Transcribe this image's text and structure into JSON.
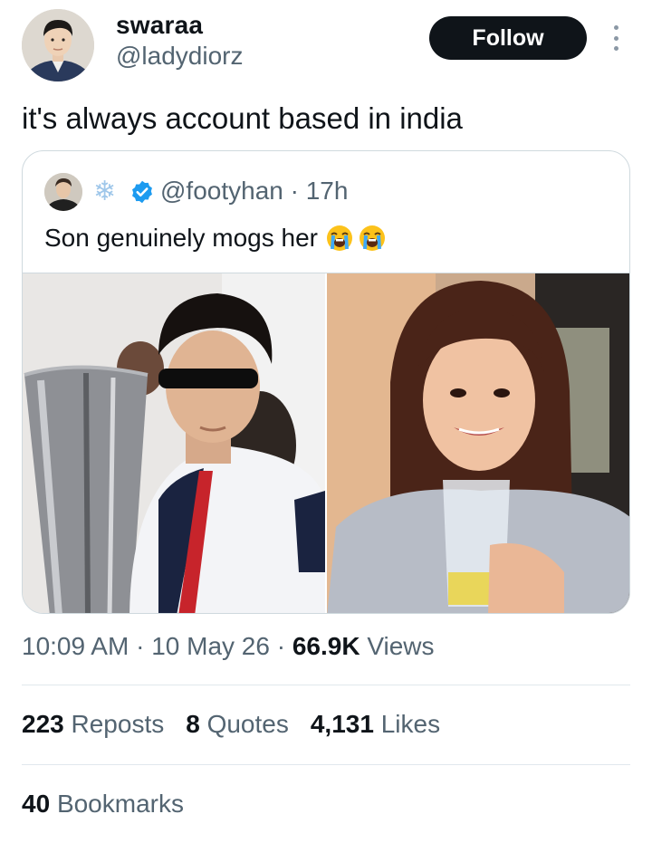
{
  "author": {
    "name": "swaraa",
    "handle": "@ladydiorz",
    "avatar_icon": "profile-photo"
  },
  "follow_label": "Follow",
  "tweet_text": "it's always account based in india",
  "quoted": {
    "handle": "@footyhan",
    "separator": " · ",
    "time": "17h",
    "text": "Son genuinely mogs her",
    "badge_icon": "snowflake-icon",
    "verified_icon": "verified-badge-icon",
    "emoji_icons": [
      "loudly-crying-face-emoji",
      "loudly-crying-face-emoji"
    ],
    "images": [
      "footballer-with-sunglasses-and-trophy-photo",
      "woman-smiling-holding-glass-photo"
    ]
  },
  "timestamp": {
    "time": "10:09 AM",
    "date": "10 May 26",
    "views_count": "66.9K",
    "views_label": "Views",
    "separator": " · "
  },
  "stats": {
    "reposts_count": "223",
    "reposts_label": "Reposts",
    "quotes_count": "8",
    "quotes_label": "Quotes",
    "likes_count": "4,131",
    "likes_label": "Likes",
    "bookmarks_count": "40",
    "bookmarks_label": "Bookmarks"
  },
  "colors": {
    "text_primary": "#0f1419",
    "text_secondary": "#536471",
    "follow_bg": "#0f1419",
    "verified_blue": "#1d9bf0",
    "border": "#cfd9de"
  }
}
